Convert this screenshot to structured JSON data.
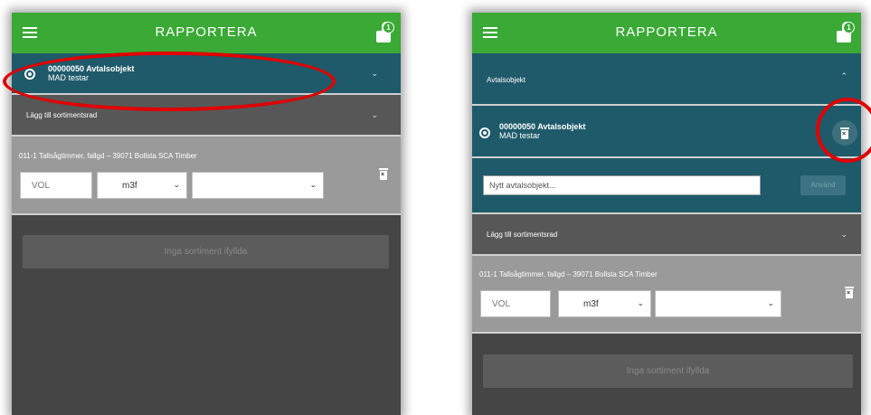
{
  "app_bar": {
    "title": "RAPPORTERA",
    "lock_badge": "1"
  },
  "left": {
    "object_row": {
      "title": "00000050 Avtalsobjekt",
      "subtitle": "MAD testar"
    },
    "add_row_label": "Lägg till sortimentsrad",
    "assortment": {
      "label": "011-1 Tallsågtimmer, fallgd – 39071 Bollsta SCA Timber",
      "vol_placeholder": "VOL",
      "unit": "m3f",
      "extra": ""
    },
    "empty_button": "Inga sortiment ifyllda"
  },
  "right": {
    "section_header": "Avtalsobjekt",
    "object_row": {
      "title": "00000050 Avtalsobjekt",
      "subtitle": "MAD testar"
    },
    "new_object_placeholder": "Nytt avtalsobjekt...",
    "use_button": "Använd",
    "add_row_label": "Lägg till sortimentsrad",
    "assortment": {
      "label": "011-1 Tallsågtimmer, fallgd – 39071 Bollsta SCA Timber",
      "vol_placeholder": "VOL",
      "unit": "m3f",
      "extra": ""
    },
    "empty_button": "Inga sortiment ifyllda"
  },
  "colors": {
    "app_bar": "#3aa935",
    "teal_section": "#1f5a6a",
    "annotation": "#e00000"
  },
  "icons": [
    "hamburger-icon",
    "lock-icon",
    "radio-selected-icon",
    "chevron-down-icon",
    "chevron-up-icon",
    "trash-icon"
  ]
}
